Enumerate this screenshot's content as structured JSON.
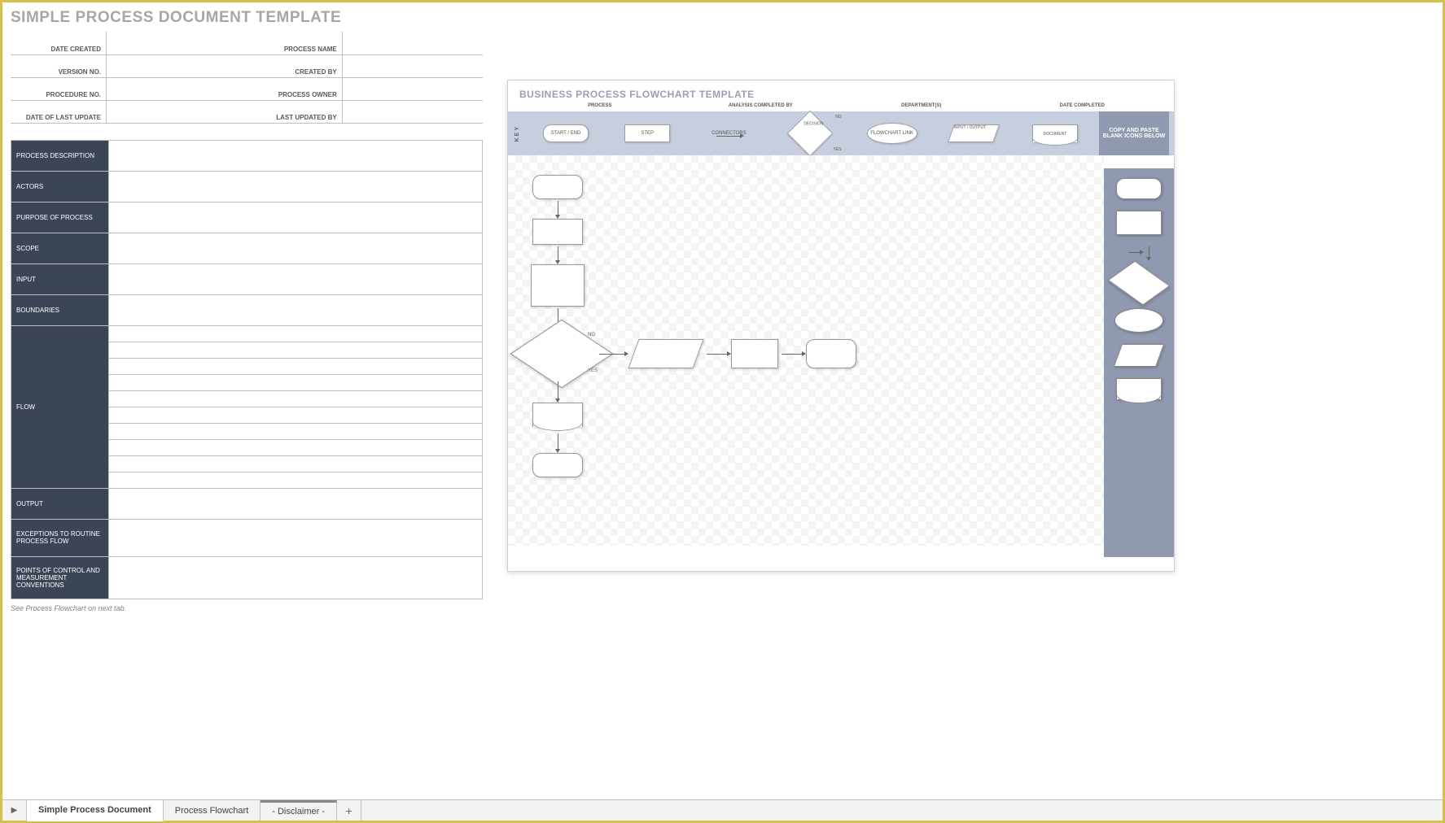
{
  "left": {
    "title": "SIMPLE PROCESS DOCUMENT TEMPLATE",
    "meta": {
      "date_created": "DATE CREATED",
      "process_name": "PROCESS NAME",
      "version_no": "VERSION NO.",
      "created_by": "CREATED BY",
      "procedure_no": "PROCEDURE NO.",
      "process_owner": "PROCESS OWNER",
      "date_last_update": "DATE OF LAST UPDATE",
      "last_updated_by": "LAST UPDATED BY"
    },
    "sections": {
      "process_description": "PROCESS DESCRIPTION",
      "actors": "ACTORS",
      "purpose": "PURPOSE OF PROCESS",
      "scope": "SCOPE",
      "input": "INPUT",
      "boundaries": "BOUNDARIES",
      "flow": "FLOW",
      "output": "OUTPUT",
      "exceptions": "EXCEPTIONS TO ROUTINE PROCESS FLOW",
      "points": "POINTS OF CONTROL AND MEASUREMENT CONVENTIONS"
    },
    "footnote": "See Process Flowchart on next tab."
  },
  "right": {
    "title": "BUSINESS PROCESS FLOWCHART TEMPLATE",
    "headers": {
      "process": "PROCESS",
      "analysis": "ANALYSIS COMPLETED BY",
      "departments": "DEPARTMENT(S)",
      "date_completed": "DATE COMPLETED"
    },
    "legend": {
      "key": "KEY",
      "start_end": "START / END",
      "step": "STEP",
      "connectors": "CONNECTORS",
      "decision": "DECISION",
      "decision_no": "NO",
      "decision_yes": "YES",
      "flowchart_link": "FLOWCHART LINK",
      "input_output": "INPUT / OUTPUT",
      "document": "DOCUMENT",
      "copy_paste": "COPY AND PASTE BLANK ICONS BELOW"
    },
    "canvas_labels": {
      "no": "NO",
      "yes": "YES"
    }
  },
  "tabs": {
    "t1": "Simple Process Document",
    "t2": "Process Flowchart",
    "t3": "- Disclaimer -",
    "add": "+"
  }
}
